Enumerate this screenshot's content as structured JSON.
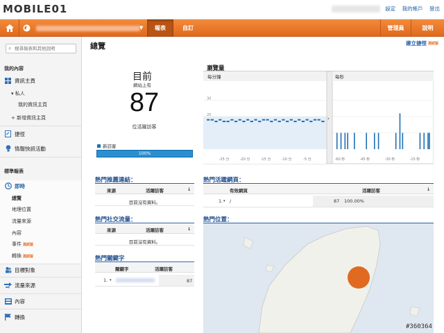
{
  "header": {
    "logo_text": "MOBILE01",
    "links": [
      "設定",
      "我的帳戶",
      "登出"
    ]
  },
  "nav": {
    "tabs": [
      "報表",
      "自訂"
    ],
    "right_tabs": [
      "管理員",
      "說明"
    ]
  },
  "sidebar": {
    "search_placeholder": "搜尋報表和其他說明",
    "my_content_heading": "我的內容",
    "dashboards_label": "資訊主頁",
    "private_label": "▾ 私人",
    "my_dashboard_label": "我的資訊主頁",
    "new_dashboard_label": "+ 新增資訊主頁",
    "shortcuts_label": "捷徑",
    "intelligence_label": "情報快訊活動",
    "standard_reports_heading": "標準報表",
    "realtime_label": "即時",
    "realtime_items": [
      "總覽",
      "地理位置",
      "流量來源",
      "內容",
      "事件",
      "轉換"
    ],
    "beta_label": "測試版",
    "audience_label": "目標對象",
    "acquisition_label": "流量來源",
    "content_label": "內容",
    "conversions_label": "轉換"
  },
  "main": {
    "title": "總覽",
    "create_link": "建立捷徑",
    "beta_label": "測試版",
    "now_label": "目前",
    "now_sub": "網站上有",
    "active_visitors": "87",
    "active_caption": "位活躍訪客",
    "new_visitor_legend": "新訪客",
    "new_visitor_percent": 100,
    "new_visitor_pct_text": "100%",
    "pageviews": {
      "title": "瀏覽量",
      "per_minute_label": "每分鐘",
      "per_second_label": "每秒",
      "y_ticks": [
        "30",
        "20",
        "10"
      ],
      "minute_x_ticks": [
        "-25 分",
        "-20 分",
        "-15 分",
        "-10 分",
        "-5 分"
      ],
      "second_x_ticks": [
        "-60 秒",
        "-45 秒",
        "-30 秒",
        "-15 秒"
      ]
    },
    "referrals": {
      "title": "熱門推薦連結：",
      "col_source": "來源",
      "col_active": "活躍訪客",
      "empty": "目前沒有資料。"
    },
    "social": {
      "title": "熱門社交流量：",
      "col_source": "來源",
      "col_active": "活躍訪客",
      "empty": "目前沒有資料。"
    },
    "keywords": {
      "title": "熱門關鍵字",
      "col_keyword": "關鍵字",
      "col_active": "活躍訪客",
      "rows": [
        {
          "index": "1.",
          "count": "87"
        }
      ]
    },
    "active_pages": {
      "title": "熱門活躍網頁：",
      "col_page": "有效網頁",
      "col_active": "活躍訪客",
      "rows": [
        {
          "index": "1.",
          "page": "/",
          "count": "87",
          "percent": "100.00%"
        }
      ]
    },
    "locations": {
      "title": "熱門位置："
    }
  },
  "chart_data": [
    {
      "type": "bar",
      "title": "每分鐘",
      "ylim": [
        0,
        40
      ],
      "x_ticks": [
        "-25 分",
        "-20 分",
        "-15 分",
        "-10 分",
        "-5 分"
      ],
      "values": [
        18,
        18,
        17,
        18,
        17,
        17,
        18,
        17,
        18,
        17,
        18,
        17,
        18,
        17,
        18,
        18,
        17,
        18,
        17,
        18,
        17,
        18,
        17,
        18,
        17,
        18,
        17,
        18,
        18,
        17
      ]
    },
    {
      "type": "bar",
      "title": "每秒",
      "ylim": [
        0,
        40
      ],
      "x_ticks": [
        "-60 秒",
        "-45 秒",
        "-30 秒",
        "-15 秒"
      ],
      "values": [
        0,
        10,
        0,
        0,
        10,
        0,
        0,
        10,
        0,
        10,
        0,
        0,
        0,
        0,
        10,
        0,
        0,
        0,
        0,
        0,
        0,
        0,
        0,
        10,
        0,
        0,
        0,
        0,
        0,
        10,
        0,
        0,
        10,
        0,
        0,
        0,
        0,
        0,
        0,
        0,
        0,
        0,
        0,
        0,
        0,
        10,
        0,
        0,
        22,
        0,
        10,
        0,
        0,
        0,
        0,
        0,
        0,
        0,
        0,
        0,
        0,
        0,
        0,
        10,
        0,
        0,
        10,
        0,
        0,
        10,
        10,
        0
      ]
    }
  ]
}
